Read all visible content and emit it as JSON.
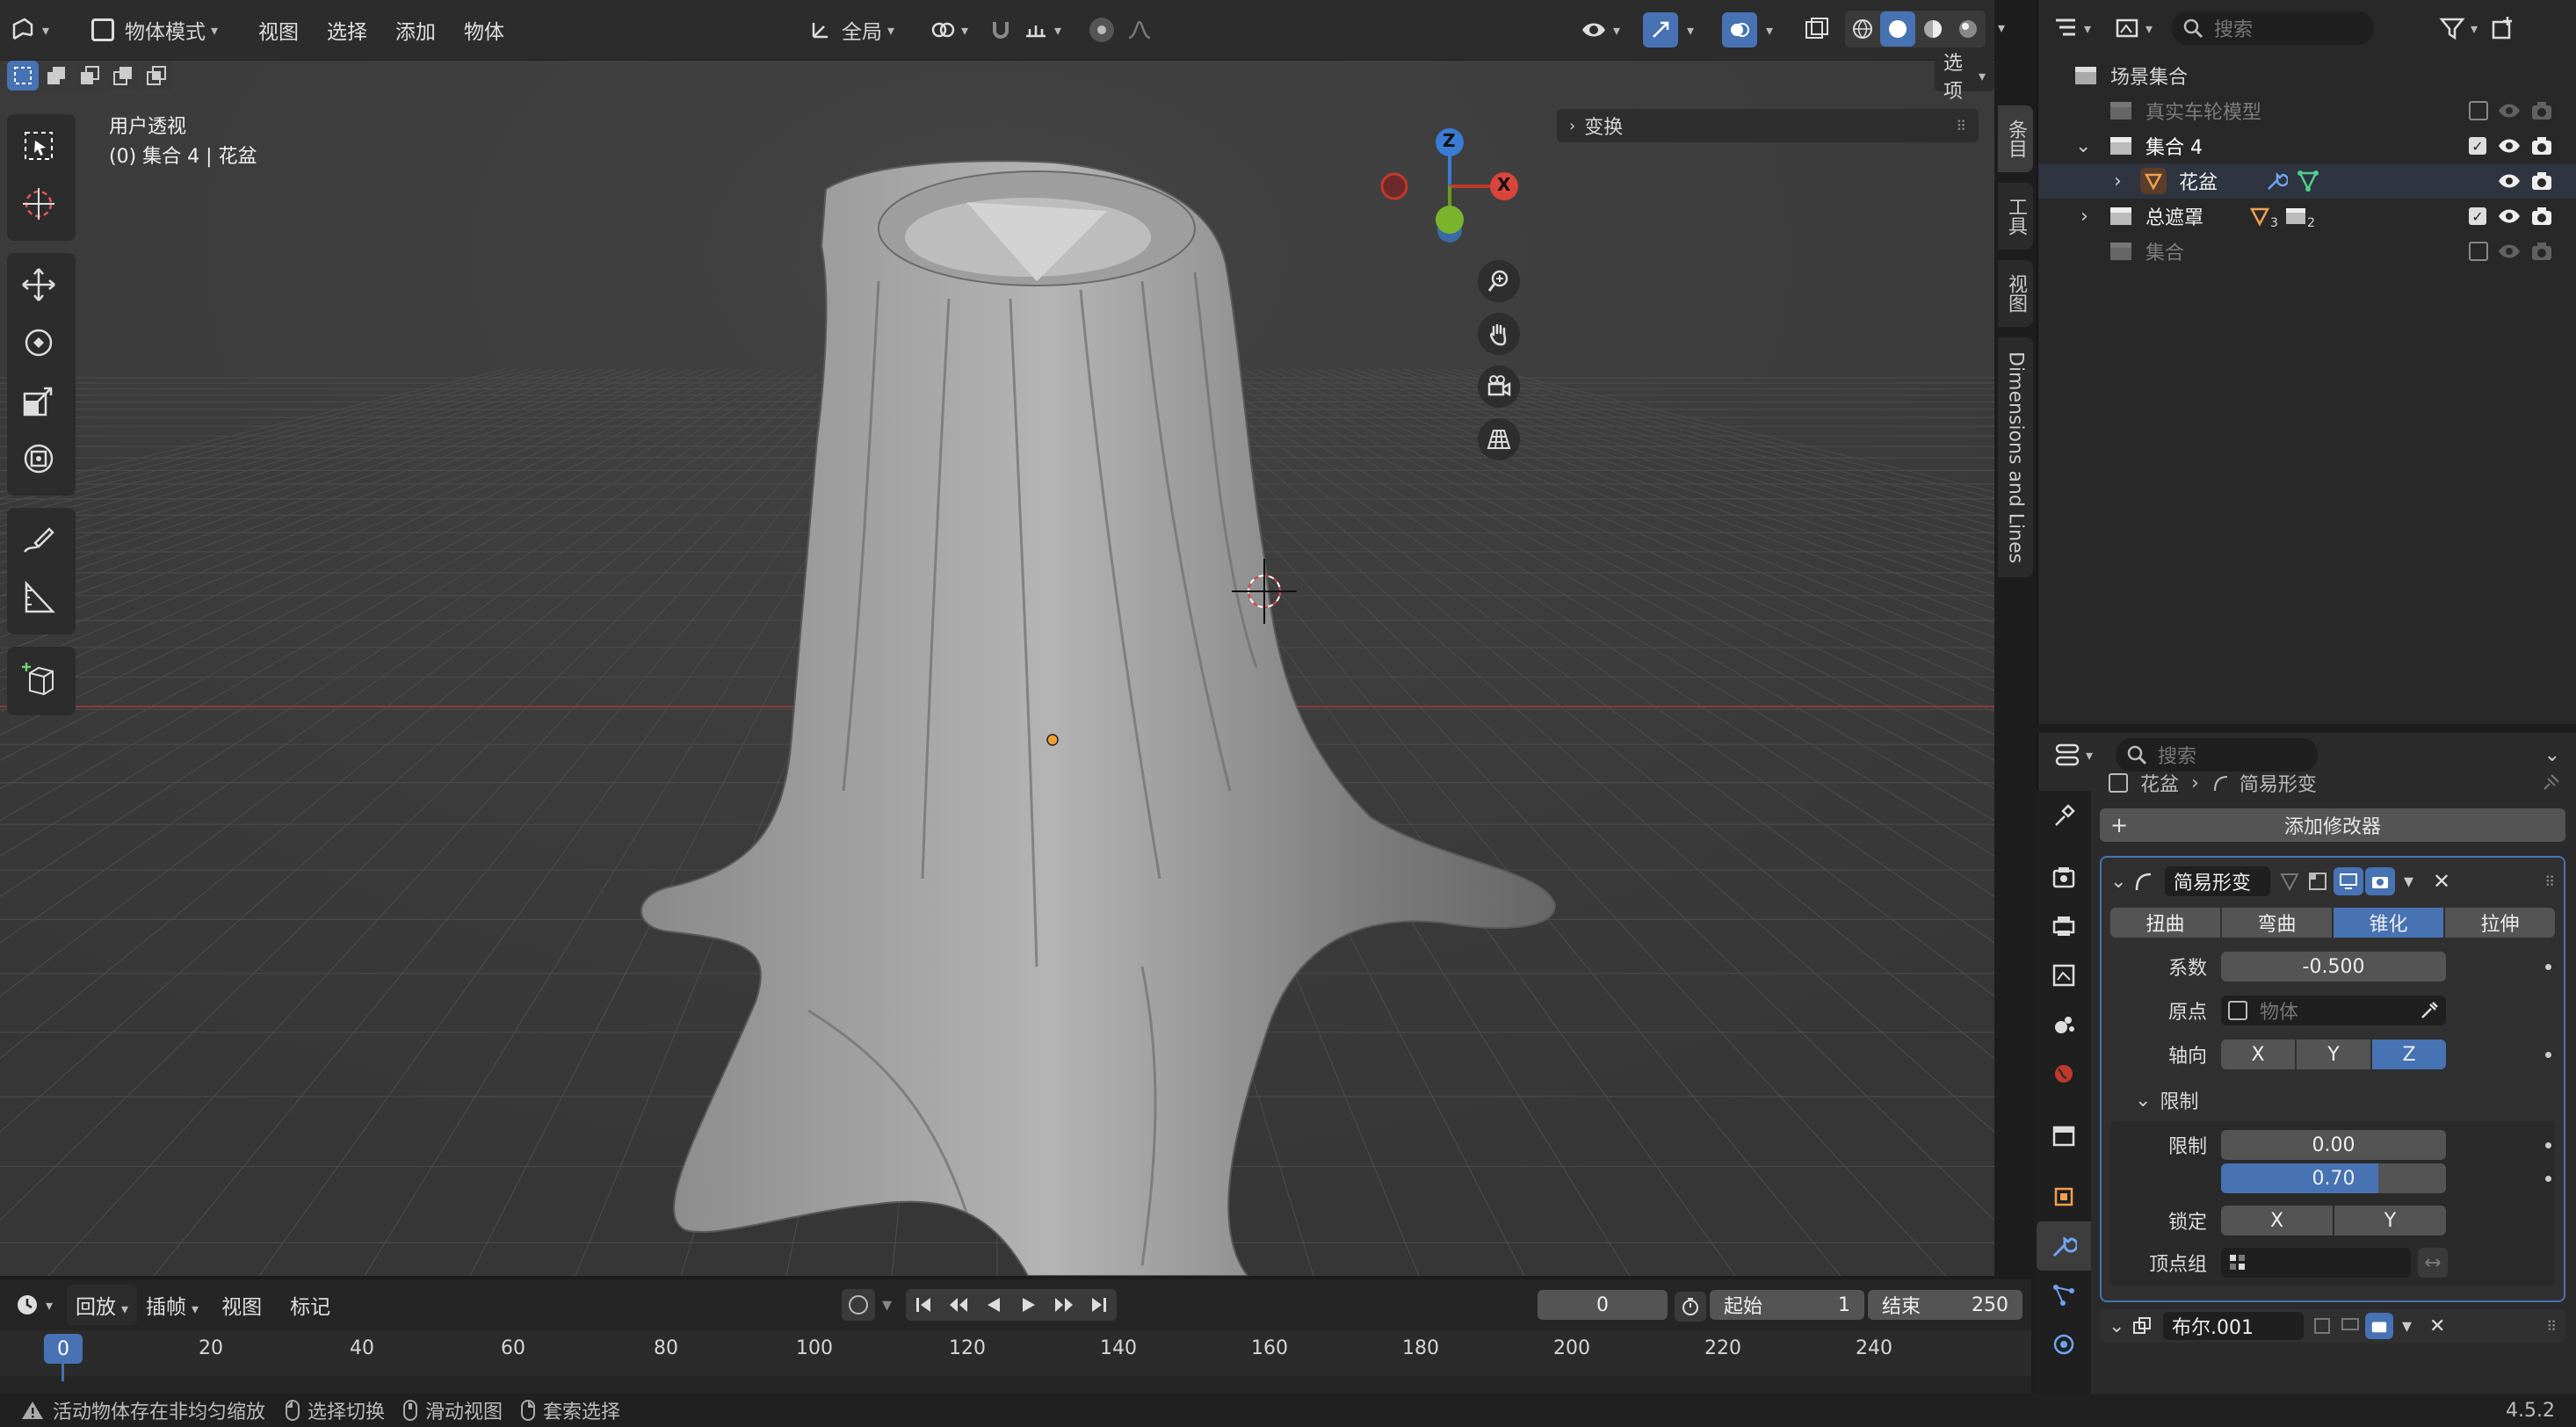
{
  "header": {
    "mode": "物体模式",
    "menus": [
      "视图",
      "选择",
      "添加",
      "物体"
    ],
    "transform_orientation": "全局",
    "options_label": "选项"
  },
  "viewport": {
    "view_name": "用户透视",
    "collection_info": "(0) 集合 4 | 花盆",
    "transform_panel": "变换",
    "gizmo": {
      "z": "Z",
      "x": "X"
    }
  },
  "side_tabs": [
    "条目",
    "工具",
    "视图",
    "Dimensions and Lines"
  ],
  "outliner": {
    "search_placeholder": "搜索",
    "root": "场景集合",
    "items": [
      {
        "label": "真实车轮模型",
        "checked": false,
        "dim": true
      },
      {
        "label": "集合 4",
        "checked": true,
        "dim": false
      },
      {
        "label": "花盆",
        "checked": null,
        "dim": false
      },
      {
        "label": "总遮罩",
        "checked": true,
        "dim": false,
        "sub1": "3",
        "sub2": "2"
      },
      {
        "label": "集合",
        "checked": false,
        "dim": true
      }
    ]
  },
  "properties": {
    "search_placeholder": "搜索",
    "breadcrumb_object": "花盆",
    "breadcrumb_modifier": "简易形变",
    "add_modifier": "添加修改器",
    "modifier_name": "简易形变",
    "mode_tabs": [
      "扭曲",
      "弯曲",
      "锥化",
      "拉伸"
    ],
    "active_mode": "锥化",
    "factor_label": "系数",
    "factor_value": "-0.500",
    "origin_label": "原点",
    "origin_placeholder": "物体",
    "axis_label": "轴向",
    "axes": [
      "X",
      "Y",
      "Z"
    ],
    "active_axis": "Z",
    "limits_section": "限制",
    "limits_label": "限制",
    "limit_low": "0.00",
    "limit_high": "0.70",
    "lock_label": "锁定",
    "lock_axes": [
      "X",
      "Y"
    ],
    "vertex_group_label": "顶点组",
    "next_modifier": "布尔.001"
  },
  "timeline": {
    "playback": "回放",
    "keying": "插帧",
    "view": "视图",
    "marker": "标记",
    "current_frame": "0",
    "start_label": "起始",
    "start_value": "1",
    "end_label": "结束",
    "end_value": "250",
    "ruler": [
      "0",
      "20",
      "40",
      "60",
      "80",
      "100",
      "120",
      "140",
      "160",
      "180",
      "200",
      "220",
      "240"
    ]
  },
  "status": {
    "warning": "活动物体存在非均匀缩放",
    "hints": [
      "选择切换",
      "滑动视图",
      "套索选择"
    ],
    "version": "4.5.2"
  },
  "colors": {
    "accent": "#4772b3",
    "axis_red": "#c0392b",
    "axis_green": "#6b9a1e",
    "axis_blue": "#3a7bd5"
  }
}
